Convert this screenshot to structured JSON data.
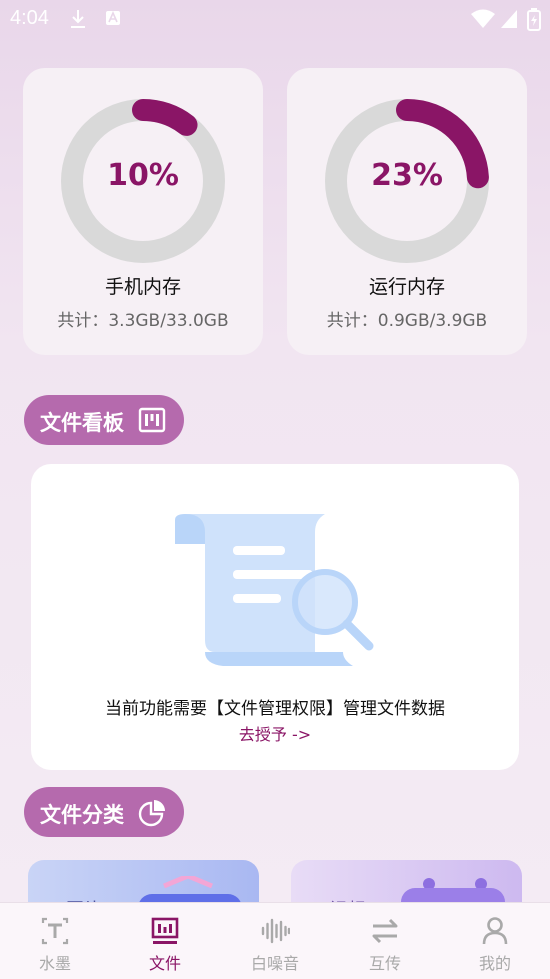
{
  "status_bar": {
    "time": "4:04"
  },
  "storage_cards": [
    {
      "percent_label": "10%",
      "percent_value": 0.1,
      "title": "手机内存",
      "subtitle": "共计：3.3GB/33.0GB"
    },
    {
      "percent_label": "23%",
      "percent_value": 0.23,
      "title": "运行内存",
      "subtitle": "共计：0.9GB/3.9GB"
    }
  ],
  "file_board": {
    "section_label": "文件看板",
    "message": "当前功能需要【文件管理权限】管理文件数据",
    "action": "去授予 ->"
  },
  "file_category": {
    "section_label": "文件分类",
    "items": [
      "图片",
      "视频"
    ]
  },
  "tabs": [
    {
      "label": "水墨",
      "icon": "text-icon",
      "active": false
    },
    {
      "label": "文件",
      "icon": "file-board-icon",
      "active": true
    },
    {
      "label": "白噪音",
      "icon": "waveform-icon",
      "active": false
    },
    {
      "label": "互传",
      "icon": "transfer-icon",
      "active": false
    },
    {
      "label": "我的",
      "icon": "person-icon",
      "active": false
    }
  ],
  "colors": {
    "accent": "#8a1566",
    "pill": "#b56aad",
    "ring_track": "#d9d9d9",
    "tab_inactive": "#a9a9a9"
  }
}
